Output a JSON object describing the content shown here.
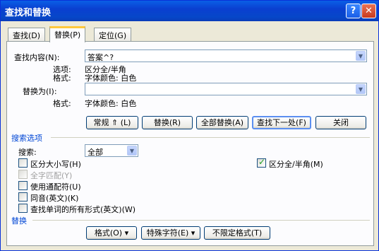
{
  "window": {
    "title": "查找和替换",
    "help_label": "?",
    "close_label": "✕"
  },
  "tabs": [
    {
      "label": "查找(D)",
      "active": false
    },
    {
      "label": "替换(P)",
      "active": true
    },
    {
      "label": "定位(G)",
      "active": false
    }
  ],
  "find": {
    "label": "查找内容(N):",
    "value": "答案^?",
    "options_label": "选项:",
    "options_value": "区分全/半角",
    "format_label": "格式:",
    "format_value": "字体颜色: 白色"
  },
  "replace": {
    "label": "替换为(I):",
    "value": "",
    "format_label": "格式:",
    "format_value": "字体颜色: 白色"
  },
  "buttons": {
    "less": "常规 ⇑ (L)",
    "replace": "替换(R)",
    "replace_all": "全部替换(A)",
    "find_next": "查找下一处(F)",
    "close": "关闭"
  },
  "search_options": {
    "section_label": "搜索选项",
    "search_label": "搜索:",
    "search_value": "全部",
    "checkboxes": [
      {
        "label": "区分大小写(H)",
        "checked": false,
        "enabled": true
      },
      {
        "label": "全字匹配(Y)",
        "checked": false,
        "enabled": false
      },
      {
        "label": "使用通配符(U)",
        "checked": false,
        "enabled": true
      },
      {
        "label": "同音(英文)(K)",
        "checked": false,
        "enabled": true
      },
      {
        "label": "查找单词的所有形式(英文)(W)",
        "checked": false,
        "enabled": true
      }
    ],
    "width_checkbox": {
      "label": "区分全/半角(M)",
      "checked": true,
      "enabled": true
    }
  },
  "replace_section": {
    "section_label": "替换",
    "format_button": "格式(O) ▾",
    "special_button": "特殊字符(E) ▾",
    "no_format_button": "不限定格式(T)"
  },
  "colors": {
    "title_bar": "#0a3fd0",
    "dialog_bg": "#ece9d8",
    "section_label": "#0046d5",
    "tab_highlight": "#ffc83c"
  }
}
